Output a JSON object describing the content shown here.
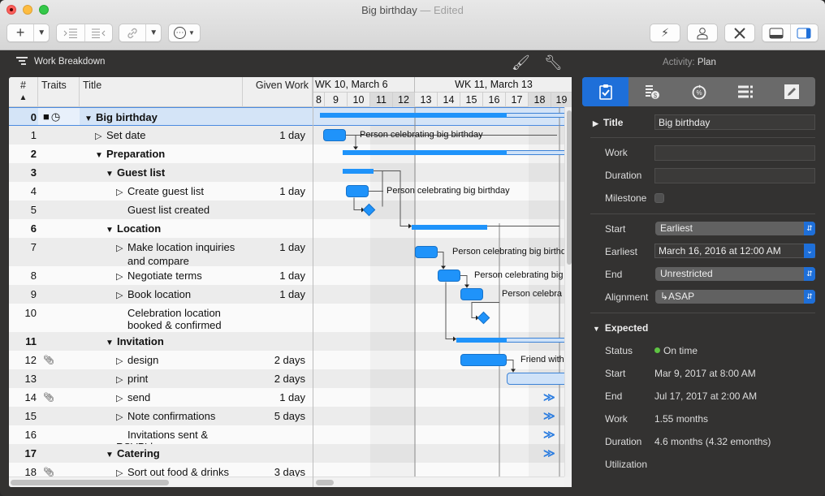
{
  "window": {
    "title": "Big birthday",
    "title_suffix": "— Edited"
  },
  "toolbar": {
    "add_icon": "+",
    "dropdown_icon": "⌄",
    "indent_icon": "indent-icon",
    "outdent_icon": "outdent-icon",
    "link_icon": "link-icon",
    "more_icon": "⋯",
    "right_buttons": [
      "leveling-icon",
      "resource-icon",
      "tools-icon",
      "bottom-pane-icon",
      "side-pane-icon"
    ]
  },
  "subbar": {
    "view_label": "Work Breakdown",
    "activity_prefix": "Activity:",
    "activity_value": "Plan"
  },
  "outline": {
    "columns": [
      "#",
      "Traits",
      "Title",
      "Given Work"
    ],
    "rows": [
      {
        "num": "0",
        "traits": "group,clock",
        "title": "Big birthday",
        "work": "",
        "bold": true,
        "level": 0,
        "disclose": "open",
        "selected": true
      },
      {
        "num": "1",
        "traits": "",
        "title": "Set date",
        "work": "1 day",
        "bold": false,
        "level": 1,
        "disclose": "closed"
      },
      {
        "num": "2",
        "traits": "",
        "title": "Preparation",
        "work": "",
        "bold": true,
        "level": 1,
        "disclose": "open"
      },
      {
        "num": "3",
        "traits": "",
        "title": "Guest list",
        "work": "",
        "bold": true,
        "level": 2,
        "disclose": "open"
      },
      {
        "num": "4",
        "traits": "",
        "title": "Create guest list",
        "work": "1 day",
        "bold": false,
        "level": 3,
        "disclose": "closed"
      },
      {
        "num": "5",
        "traits": "",
        "title": "Guest list created",
        "work": "",
        "bold": false,
        "level": 3,
        "disclose": "none"
      },
      {
        "num": "6",
        "traits": "",
        "title": "Location",
        "work": "",
        "bold": true,
        "level": 2,
        "disclose": "open"
      },
      {
        "num": "7",
        "traits": "",
        "title": "Make location inquiries",
        "title2": "and compare",
        "work": "1 day",
        "bold": false,
        "level": 3,
        "disclose": "closed"
      },
      {
        "num": "8",
        "traits": "",
        "title": "Negotiate terms",
        "work": "1 day",
        "bold": false,
        "level": 3,
        "disclose": "closed"
      },
      {
        "num": "9",
        "traits": "",
        "title": "Book location",
        "work": "1 day",
        "bold": false,
        "level": 3,
        "disclose": "closed"
      },
      {
        "num": "10",
        "traits": "",
        "title": "Celebration location",
        "title2": "booked & confirmed",
        "work": "",
        "bold": false,
        "level": 3,
        "disclose": "none"
      },
      {
        "num": "11",
        "traits": "",
        "title": "Invitation",
        "work": "",
        "bold": true,
        "level": 2,
        "disclose": "open"
      },
      {
        "num": "12",
        "traits": "attachment",
        "title": "design",
        "work": "2 days",
        "bold": false,
        "level": 3,
        "disclose": "closed"
      },
      {
        "num": "13",
        "traits": "",
        "title": "print",
        "work": "2 days",
        "bold": false,
        "level": 3,
        "disclose": "closed"
      },
      {
        "num": "14",
        "traits": "attachment",
        "title": "send",
        "work": "1 day",
        "bold": false,
        "level": 3,
        "disclose": "closed"
      },
      {
        "num": "15",
        "traits": "",
        "title": "Note confirmations",
        "work": "5 days",
        "bold": false,
        "level": 3,
        "disclose": "closed"
      },
      {
        "num": "16",
        "traits": "",
        "title": "Invitations sent & RSVP'd",
        "work": "",
        "bold": false,
        "level": 3,
        "disclose": "none"
      },
      {
        "num": "17",
        "traits": "",
        "title": "Catering",
        "work": "",
        "bold": true,
        "level": 2,
        "disclose": "open"
      },
      {
        "num": "18",
        "traits": "attachment",
        "title": "Sort out food & drinks",
        "work": "3 days",
        "bold": false,
        "level": 3,
        "disclose": "closed"
      }
    ]
  },
  "gantt": {
    "weeks": [
      "WK 10, March 6",
      "WK 11, March 13"
    ],
    "days": [
      "8",
      "9",
      "10",
      "11",
      "12",
      "13",
      "14",
      "15",
      "16",
      "17",
      "18",
      "19"
    ],
    "weekend_days": [
      "11",
      "12",
      "18",
      "19"
    ],
    "labels": {
      "r1": "Person celebrating big birthday",
      "r4": "Person celebrating big birthday",
      "r7": "Person celebrating big birthd",
      "r8": "Person celebrating big",
      "r9": "Person celebra",
      "r12": "Friend with"
    },
    "overflow_marker": "≫"
  },
  "inspector": {
    "tabs": [
      "task-icon",
      "cost-icon",
      "progress-icon",
      "structure-icon",
      "note-icon"
    ],
    "title_label": "Title",
    "title_value": "Big birthday",
    "work_label": "Work",
    "work_value": "",
    "duration_label": "Duration",
    "duration_value": "",
    "milestone_label": "Milestone",
    "start_label": "Start",
    "start_value": "Earliest",
    "earliest_label": "Earliest",
    "earliest_value": "March 16, 2016 at 12:00 AM",
    "end_label": "End",
    "end_value": "Unrestricted",
    "alignment_label": "Alignment",
    "alignment_value": "↳ASAP",
    "expected": {
      "header": "Expected",
      "status_label": "Status",
      "status_value": "On time",
      "status_color": "#5ec443",
      "start_label": "Start",
      "start_value": "Mar 9, 2017 at 8:00 AM",
      "end_label": "End",
      "end_value": "Jul 17, 2017 at 2:00 AM",
      "work_label": "Work",
      "work_value": "1.55 months",
      "duration_label": "Duration",
      "duration_value": "4.6 months (4.32 emonths)",
      "utilization_label": "Utilization",
      "utilization_value": ""
    }
  },
  "colors": {
    "accent": "#1e6fd9",
    "bar": "#1f93fa",
    "selection": "#d4e4f7"
  }
}
